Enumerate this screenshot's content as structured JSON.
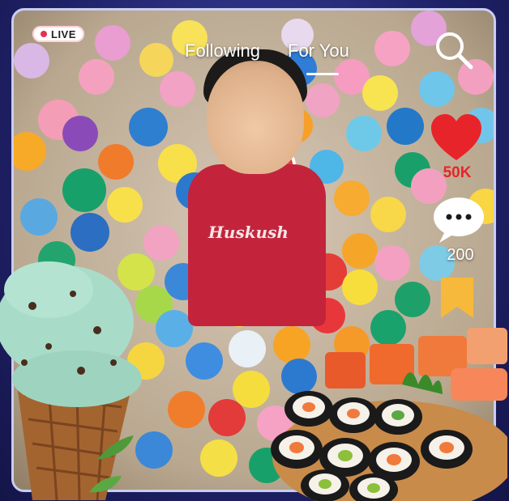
{
  "live_badge": {
    "label": "LIVE",
    "color": "#e43350"
  },
  "tabs": [
    {
      "label": "Following",
      "active": false
    },
    {
      "label": "For You",
      "active": true
    }
  ],
  "search": {
    "icon": "search-icon"
  },
  "actions": {
    "like": {
      "icon": "heart-icon",
      "count": "50K",
      "color": "#e8242b"
    },
    "comment": {
      "icon": "comment-bubble-icon",
      "count": "200"
    },
    "save": {
      "icon": "bookmark-icon",
      "color": "#f6b93b"
    }
  },
  "video": {
    "shirt_text": "Huskush"
  }
}
